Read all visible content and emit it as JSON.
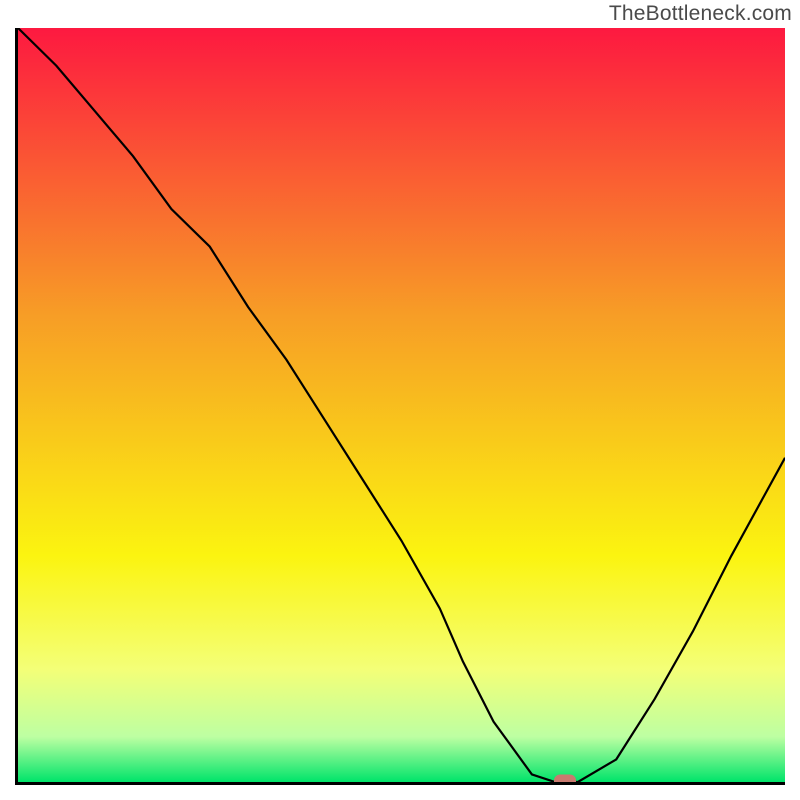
{
  "watermark": "TheBottleneck.com",
  "colors": {
    "red": "#fd1940",
    "orange": "#f79d26",
    "yellow": "#fbf410",
    "lightyellow": "#f4ff77",
    "palegreen": "#bdffa2",
    "green": "#00e46a",
    "axis": "#000000",
    "curve": "#000000",
    "marker": "#c97a6f"
  },
  "chart_data": {
    "type": "line",
    "title": "",
    "xlabel": "",
    "ylabel": "",
    "xlim": [
      0,
      100
    ],
    "ylim": [
      0,
      100
    ],
    "x": [
      0,
      5,
      10,
      15,
      20,
      25,
      30,
      35,
      40,
      45,
      50,
      55,
      58,
      62,
      67,
      70,
      73,
      78,
      83,
      88,
      93,
      100
    ],
    "values": [
      100,
      95,
      89,
      83,
      76,
      71,
      63,
      56,
      48,
      40,
      32,
      23,
      16,
      8,
      1,
      0,
      0,
      3,
      11,
      20,
      30,
      43
    ],
    "marker": {
      "x": 71,
      "y": 0
    },
    "gradient_stops": [
      {
        "pos": 0,
        "color": "#fd1940"
      },
      {
        "pos": 38,
        "color": "#f79d26"
      },
      {
        "pos": 70,
        "color": "#fbf410"
      },
      {
        "pos": 85,
        "color": "#f4ff77"
      },
      {
        "pos": 94,
        "color": "#bdffa2"
      },
      {
        "pos": 100,
        "color": "#00e46a"
      }
    ]
  }
}
